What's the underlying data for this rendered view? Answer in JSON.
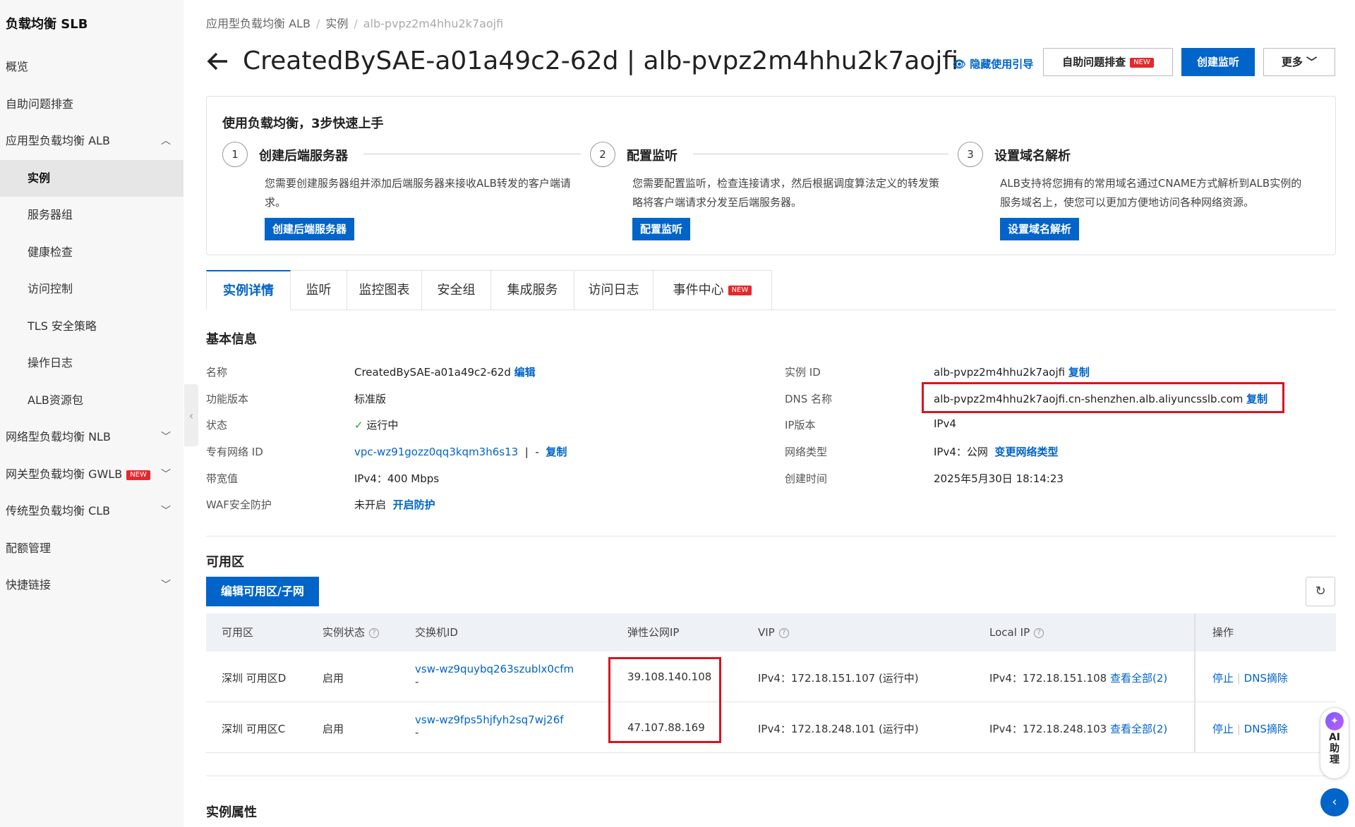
{
  "sidebar": {
    "brand": "负载均衡 SLB",
    "items": [
      {
        "label": "概览"
      },
      {
        "label": "自助问题排查"
      },
      {
        "label": "应用型负载均衡 ALB"
      },
      {
        "label": "实例"
      },
      {
        "label": "服务器组"
      },
      {
        "label": "健康检查"
      },
      {
        "label": "访问控制"
      },
      {
        "label": "TLS 安全策略"
      },
      {
        "label": "操作日志"
      },
      {
        "label": "ALB资源包"
      },
      {
        "label": "网络型负载均衡 NLB"
      },
      {
        "label": "网关型负载均衡 GWLB",
        "badge": "NEW"
      },
      {
        "label": "传统型负载均衡 CLB"
      },
      {
        "label": "配额管理"
      },
      {
        "label": "快捷链接"
      }
    ]
  },
  "breadcrumb": [
    "应用型负载均衡 ALB",
    "实例",
    "alb-pvpz2m4hhu2k7aojfi"
  ],
  "breadcrumb_sep": "/",
  "header": {
    "title": "CreatedBySAE-a01a49c2-62d | alb-pvpz2m4hhu2k7aojfi",
    "hide_guide": "隐藏使用引导",
    "self_check": "自助问题排查",
    "self_check_badge": "NEW",
    "create_listener": "创建监听",
    "more": "更多"
  },
  "guide": {
    "title": "使用负载均衡，3步快速上手",
    "steps": [
      {
        "num": "1",
        "title": "创建后端服务器",
        "desc": "您需要创建服务器组并添加后端服务器来接收ALB转发的客户端请求。",
        "button": "创建后端服务器"
      },
      {
        "num": "2",
        "title": "配置监听",
        "desc": "您需要配置监听，检查连接请求，然后根据调度算法定义的转发策略将客户端请求分发至后端服务器。",
        "button": "配置监听"
      },
      {
        "num": "3",
        "title": "设置域名解析",
        "desc": "ALB支持将您拥有的常用域名通过CNAME方式解析到ALB实例的服务域名上，使您可以更加方便地访问各种网络资源。",
        "button": "设置域名解析"
      }
    ]
  },
  "tabs": [
    {
      "label": "实例详情"
    },
    {
      "label": "监听"
    },
    {
      "label": "监控图表"
    },
    {
      "label": "安全组"
    },
    {
      "label": "集成服务"
    },
    {
      "label": "访问日志"
    },
    {
      "label": "事件中心",
      "badge": "NEW"
    }
  ],
  "basic_info": {
    "title": "基本信息",
    "left": [
      {
        "label": "名称",
        "value": "CreatedBySAE-a01a49c2-62d",
        "action": "编辑"
      },
      {
        "label": "功能版本",
        "value": "标准版"
      },
      {
        "label": "状态",
        "value": "运行中",
        "status_icon": "check-icon"
      },
      {
        "label": "专有网络 ID",
        "value": "vpc-wz91gozz0qq3kqm3h6s13",
        "sep": "|",
        "extra": "-",
        "action": "复制"
      },
      {
        "label": "带宽值",
        "value": "IPv4：400 Mbps"
      },
      {
        "label": "WAF安全防护",
        "value": "未开启",
        "action": "开启防护"
      }
    ],
    "right": [
      {
        "label": "实例 ID",
        "value": "alb-pvpz2m4hhu2k7aojfi",
        "action": "复制"
      },
      {
        "label": "DNS 名称",
        "value": "alb-pvpz2m4hhu2k7aojfi.cn-shenzhen.alb.aliyuncsslb.com",
        "action": "复制"
      },
      {
        "label": "IP版本",
        "value": "IPv4"
      },
      {
        "label": "网络类型",
        "value": "IPv4：公网",
        "action": "变更网络类型"
      },
      {
        "label": "创建时间",
        "value": "2025年5月30日 18:14:23"
      }
    ]
  },
  "zones": {
    "title": "可用区",
    "edit_button": "编辑可用区/子网",
    "columns": [
      "可用区",
      "实例状态",
      "交换机ID",
      "弹性公网IP",
      "VIP",
      "Local IP",
      "操作"
    ],
    "rows": [
      {
        "zone": "深圳 可用区D",
        "status": "启用",
        "vswitch": "vsw-wz9quybq263szublx0cfm",
        "vswitch_extra": "-",
        "eip": "39.108.140.108",
        "vip": "IPv4：172.18.151.107 (运行中)",
        "local_ip": "IPv4：172.18.151.108",
        "local_link": "查看全部(2)",
        "op1": "停止",
        "op2": "DNS摘除"
      },
      {
        "zone": "深圳 可用区C",
        "status": "启用",
        "vswitch": "vsw-wz9fps5hjfyh2sq7wj26f",
        "vswitch_extra": "-",
        "eip": "47.107.88.169",
        "vip": "IPv4：172.18.248.101 (运行中)",
        "local_ip": "IPv4：172.18.248.103",
        "local_link": "查看全部(2)",
        "op1": "停止",
        "op2": "DNS摘除"
      }
    ]
  },
  "instance_props": {
    "title": "实例属性"
  },
  "ai_helper": {
    "label1": "AI",
    "label2": "助",
    "label3": "理"
  },
  "colors": {
    "accent": "#0064c8",
    "highlight": "#d8141f",
    "running": "#2e9e3f"
  },
  "icons": [
    "back-arrow-icon",
    "eye-icon",
    "chevron-down-icon",
    "chevron-up-icon",
    "check-icon",
    "question-icon",
    "refresh-icon",
    "chevron-left-icon",
    "ai-spark-icon"
  ]
}
